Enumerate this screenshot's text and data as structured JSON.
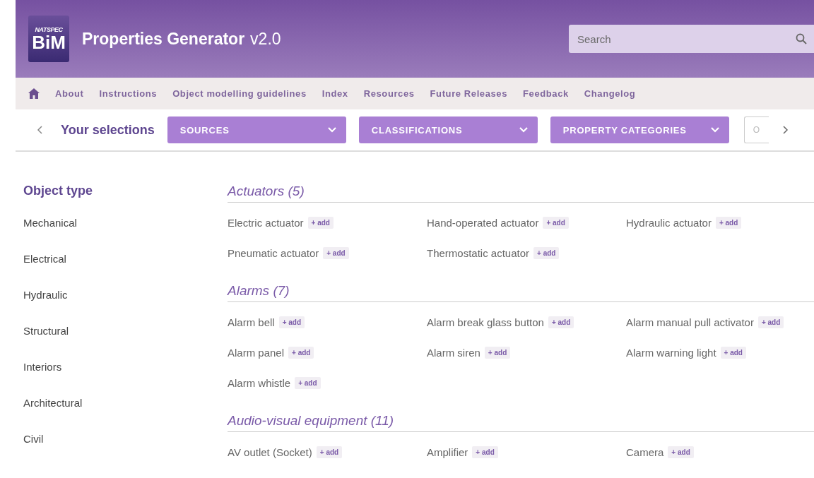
{
  "header": {
    "logo_top": "NATSPEC",
    "logo_main": "BiM",
    "title": "Properties Generator",
    "version": "v2.0",
    "search": {
      "placeholder": "Search"
    }
  },
  "nav": {
    "items": [
      "About",
      "Instructions",
      "Object modelling guidelines",
      "Index",
      "Resources",
      "Future Releases",
      "Feedback",
      "Changelog"
    ]
  },
  "selections": {
    "label": "Your selections",
    "dropdowns": [
      "SOURCES",
      "CLASSIFICATIONS",
      "PROPERTY CATEGORIES"
    ],
    "cut_field": "O"
  },
  "sidebar": {
    "title": "Object type",
    "items": [
      "Mechanical",
      "Electrical",
      "Hydraulic",
      "Structural",
      "Interiors",
      "Architectural",
      "Civil"
    ]
  },
  "groups": [
    {
      "title": "Actuators (5)",
      "items": [
        {
          "name": "Electric actuator",
          "add": "+ add"
        },
        {
          "name": "Hand-operated actuator",
          "add": "+ add"
        },
        {
          "name": "Hydraulic actuator",
          "add": "+ add"
        },
        {
          "name": "Pneumatic actuator",
          "add": "+ add"
        },
        {
          "name": "Thermostatic actuator",
          "add": "+ add"
        }
      ]
    },
    {
      "title": "Alarms (7)",
      "items": [
        {
          "name": "Alarm bell",
          "add": "+ add"
        },
        {
          "name": "Alarm break glass button",
          "add": "+ add"
        },
        {
          "name": "Alarm manual pull activator",
          "add": "+ add"
        },
        {
          "name": "Alarm panel",
          "add": "+ add"
        },
        {
          "name": "Alarm siren",
          "add": "+ add"
        },
        {
          "name": "Alarm warning light",
          "add": "+ add"
        },
        {
          "name": "Alarm whistle",
          "add": "+ add"
        }
      ]
    },
    {
      "title": "Audio-visual equipment (11)",
      "items": [
        {
          "name": "AV outlet (Socket)",
          "add": "+ add"
        },
        {
          "name": "Amplifier",
          "add": "+ add"
        },
        {
          "name": "Camera",
          "add": "+ add"
        }
      ]
    }
  ]
}
